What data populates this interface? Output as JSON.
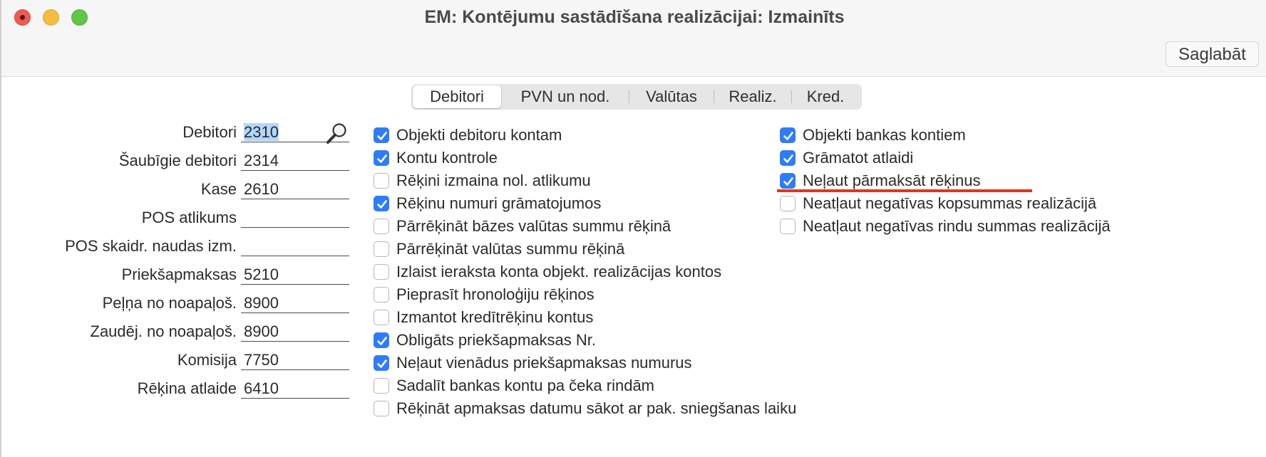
{
  "window": {
    "title": "EM: Kontējumu sastādīšana realizācijai: Izmainīts",
    "save_label": "Saglabāt"
  },
  "tabs": [
    {
      "label": "Debitori",
      "active": true
    },
    {
      "label": "PVN un nod.",
      "active": false
    },
    {
      "label": "Valūtas",
      "active": false
    },
    {
      "label": "Realiz.",
      "active": false
    },
    {
      "label": "Kred.",
      "active": false
    }
  ],
  "fields": [
    {
      "label": "Debitori",
      "value": "2310"
    },
    {
      "label": "Šaubīgie debitori",
      "value": "2314"
    },
    {
      "label": "Kase",
      "value": "2610"
    },
    {
      "label": "POS atlikums",
      "value": ""
    },
    {
      "label": "POS skaidr. naudas izm.",
      "value": ""
    },
    {
      "label": "Priekšapmaksas",
      "value": "5210"
    },
    {
      "label": "Peļņa no noapaļoš.",
      "value": "8900"
    },
    {
      "label": "Zaudēj. no noapaļoš.",
      "value": "8900"
    },
    {
      "label": "Komisija",
      "value": "7750"
    },
    {
      "label": "Rēķina atlaide",
      "value": "6410"
    }
  ],
  "checkboxes_middle": [
    {
      "label": "Objekti debitoru kontam",
      "checked": true
    },
    {
      "label": "Kontu kontrole",
      "checked": true
    },
    {
      "label": "Rēķini izmaina nol. atlikumu",
      "checked": false
    },
    {
      "label": "Rēķinu numuri grāmatojumos",
      "checked": true
    },
    {
      "label": "Pārrēķināt bāzes valūtas summu rēķinā",
      "checked": false
    },
    {
      "label": "Pārrēķināt valūtas summu rēķinā",
      "checked": false
    },
    {
      "label": "Izlaist ieraksta konta objekt. realizācijas kontos",
      "checked": false
    },
    {
      "label": "Pieprasīt hronoloģiju rēķinos",
      "checked": false
    },
    {
      "label": "Izmantot kredītrēķinu kontus",
      "checked": false
    },
    {
      "label": "Obligāts priekšapmaksas Nr.",
      "checked": true
    },
    {
      "label": "Neļaut vienādus priekšapmaksas numurus",
      "checked": true
    },
    {
      "label": "Sadalīt bankas kontu pa čeka rindām",
      "checked": false
    },
    {
      "label": "Rēķināt apmaksas datumu sākot ar pak. sniegšanas laiku",
      "checked": false
    }
  ],
  "checkboxes_right": [
    {
      "label": "Objekti bankas kontiem",
      "checked": true
    },
    {
      "label": "Grāmatot atlaidi",
      "checked": true
    },
    {
      "label": "Neļaut pārmaksāt rēķinus",
      "checked": true
    },
    {
      "label": "Neatļaut negatīvas kopsummas realizācijā",
      "checked": false
    },
    {
      "label": "Neatļaut negatīvas rindu summas realizācijā",
      "checked": false
    }
  ],
  "icons": {
    "close": "close-window-icon",
    "minimize": "minimize-window-icon",
    "maximize": "maximize-window-icon",
    "lookup": "magnifier-icon",
    "check": "checkmark-icon"
  },
  "colors": {
    "accent": "#2f7cf6",
    "annotation": "#e0361f",
    "selection": "#b4d5fe"
  }
}
